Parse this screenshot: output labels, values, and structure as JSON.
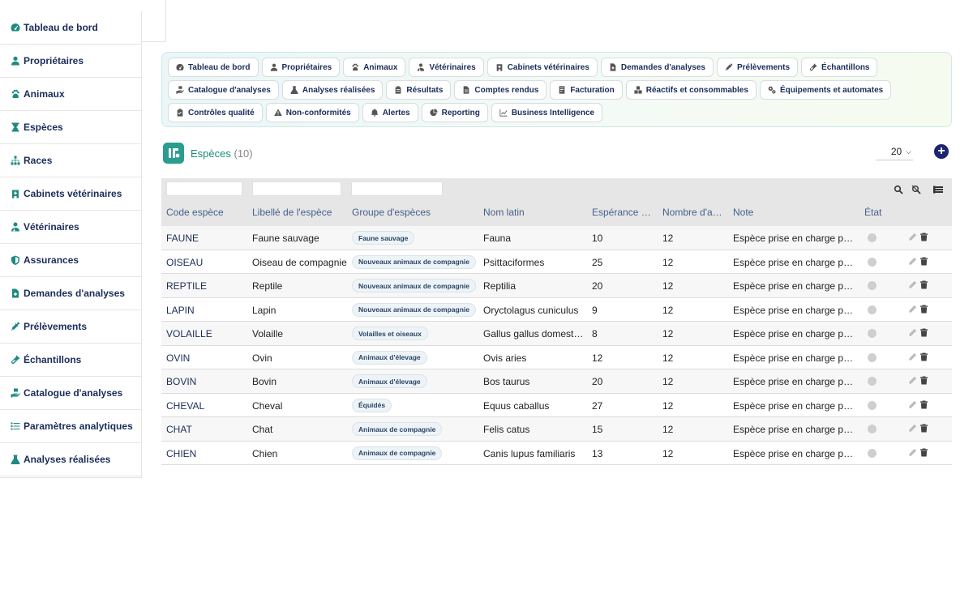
{
  "sidebar": {
    "items": [
      {
        "label": "Tableau de bord",
        "icon": "gauge-icon"
      },
      {
        "label": "Propriétaires",
        "icon": "user-icon"
      },
      {
        "label": "Animaux",
        "icon": "paw-icon"
      },
      {
        "label": "Espèces",
        "icon": "hourglass-icon"
      },
      {
        "label": "Races",
        "icon": "sitemap-icon"
      },
      {
        "label": "Cabinets vétérinaires",
        "icon": "hospital-icon"
      },
      {
        "label": "Vétérinaires",
        "icon": "doctor-icon"
      },
      {
        "label": "Assurances",
        "icon": "shield-icon"
      },
      {
        "label": "Demandes d'analyses",
        "icon": "file-medical-icon"
      },
      {
        "label": "Prélèvements",
        "icon": "syringe-icon"
      },
      {
        "label": "Échantillons",
        "icon": "vial-icon"
      },
      {
        "label": "Catalogue d'analyses",
        "icon": "hand-holding-icon"
      },
      {
        "label": "Paramètres analytiques",
        "icon": "list-icon"
      },
      {
        "label": "Analyses réalisées",
        "icon": "flask-icon"
      }
    ]
  },
  "nav_chips": [
    {
      "label": "Tableau de bord",
      "icon": "gauge-icon"
    },
    {
      "label": "Propriétaires",
      "icon": "user-icon"
    },
    {
      "label": "Animaux",
      "icon": "paw-icon"
    },
    {
      "label": "Vétérinaires",
      "icon": "doctor-icon"
    },
    {
      "label": "Cabinets vétérinaires",
      "icon": "hospital-icon"
    },
    {
      "label": "Demandes d'analyses",
      "icon": "file-medical-icon"
    },
    {
      "label": "Prélèvements",
      "icon": "syringe-icon"
    },
    {
      "label": "Échantillons",
      "icon": "vial-icon"
    },
    {
      "label": "Catalogue d'analyses",
      "icon": "hand-holding-icon"
    },
    {
      "label": "Analyses réalisées",
      "icon": "flask-icon"
    },
    {
      "label": "Résultats",
      "icon": "clipboard-icon"
    },
    {
      "label": "Comptes rendus",
      "icon": "file-icon"
    },
    {
      "label": "Facturation",
      "icon": "invoice-icon"
    },
    {
      "label": "Réactifs et consommables",
      "icon": "boxes-icon"
    },
    {
      "label": "Équipements et automates",
      "icon": "gears-icon"
    },
    {
      "label": "Contrôles qualité",
      "icon": "clipboard-check-icon"
    },
    {
      "label": "Non-conformités",
      "icon": "warning-icon"
    },
    {
      "label": "Alertes",
      "icon": "bell-icon"
    },
    {
      "label": "Reporting",
      "icon": "pie-chart-icon"
    },
    {
      "label": "Business Intelligence",
      "icon": "line-chart-icon"
    }
  ],
  "header": {
    "title": "Espèces",
    "count": "(10)",
    "per_page": "20"
  },
  "table": {
    "columns": [
      "Code espèce",
      "Libellé de l'espèce",
      "Groupe d'espèces",
      "Nom latin",
      "Espérance de vie",
      "Nombre d'analyses",
      "Note",
      "État"
    ],
    "rows": [
      {
        "code": "FAUNE",
        "label": "Faune sauvage",
        "group": "Faune sauvage",
        "latin": "Fauna",
        "life": "10",
        "count": "12",
        "note": "Espèce prise en charge par le laboratoire"
      },
      {
        "code": "OISEAU",
        "label": "Oiseau de compagnie",
        "group": "Nouveaux animaux de compagnie",
        "latin": "Psittaciformes",
        "life": "25",
        "count": "12",
        "note": "Espèce prise en charge par le laboratoire"
      },
      {
        "code": "REPTILE",
        "label": "Reptile",
        "group": "Nouveaux animaux de compagnie",
        "latin": "Reptilia",
        "life": "20",
        "count": "12",
        "note": "Espèce prise en charge par le laboratoire"
      },
      {
        "code": "LAPIN",
        "label": "Lapin",
        "group": "Nouveaux animaux de compagnie",
        "latin": "Oryctolagus cuniculus",
        "life": "9",
        "count": "12",
        "note": "Espèce prise en charge par le laboratoire"
      },
      {
        "code": "VOLAILLE",
        "label": "Volaille",
        "group": "Volailles et oiseaux",
        "latin": "Gallus gallus domesticus",
        "life": "8",
        "count": "12",
        "note": "Espèce prise en charge par le laboratoire"
      },
      {
        "code": "OVIN",
        "label": "Ovin",
        "group": "Animaux d'élevage",
        "latin": "Ovis aries",
        "life": "12",
        "count": "12",
        "note": "Espèce prise en charge par le laboratoire"
      },
      {
        "code": "BOVIN",
        "label": "Bovin",
        "group": "Animaux d'élevage",
        "latin": "Bos taurus",
        "life": "20",
        "count": "12",
        "note": "Espèce prise en charge par le laboratoire"
      },
      {
        "code": "CHEVAL",
        "label": "Cheval",
        "group": "Équidés",
        "latin": "Equus caballus",
        "life": "27",
        "count": "12",
        "note": "Espèce prise en charge par le laboratoire"
      },
      {
        "code": "CHAT",
        "label": "Chat",
        "group": "Animaux de compagnie",
        "latin": "Felis catus",
        "life": "15",
        "count": "12",
        "note": "Espèce prise en charge par le laboratoire"
      },
      {
        "code": "CHIEN",
        "label": "Chien",
        "group": "Animaux de compagnie",
        "latin": "Canis lupus familiaris",
        "life": "13",
        "count": "12",
        "note": "Espèce prise en charge par le laboratoire"
      }
    ]
  },
  "colors": {
    "accent": "#1e8a82",
    "navy": "#1b2c5a",
    "add_button": "#1b2570"
  }
}
